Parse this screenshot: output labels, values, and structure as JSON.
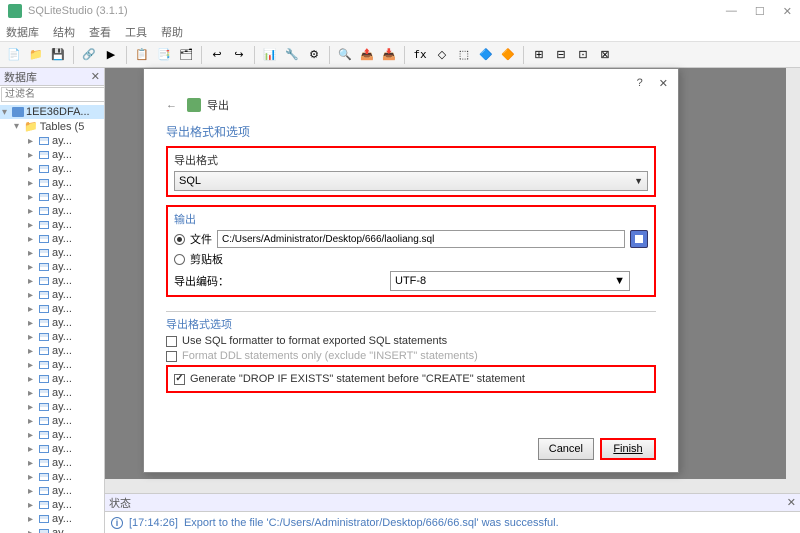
{
  "app": {
    "title": "SQLiteStudio (3.1.1)"
  },
  "menu": {
    "database": "数据库",
    "structure": "结构",
    "view": "查看",
    "tools": "工具",
    "help": "帮助"
  },
  "sidebar": {
    "header": "数据库",
    "filter_placeholder": "过滤名",
    "db_name": "1EE36DFA...",
    "tables_label": "Tables (5",
    "items": [
      {
        "label": "ay..."
      },
      {
        "label": "ay..."
      },
      {
        "label": "ay..."
      },
      {
        "label": "ay..."
      },
      {
        "label": "ay..."
      },
      {
        "label": "ay..."
      },
      {
        "label": "ay..."
      },
      {
        "label": "ay..."
      },
      {
        "label": "ay..."
      },
      {
        "label": "ay..."
      },
      {
        "label": "ay..."
      },
      {
        "label": "ay..."
      },
      {
        "label": "ay..."
      },
      {
        "label": "ay..."
      },
      {
        "label": "ay..."
      },
      {
        "label": "ay..."
      },
      {
        "label": "ay..."
      },
      {
        "label": "ay..."
      },
      {
        "label": "ay..."
      },
      {
        "label": "ay..."
      },
      {
        "label": "ay..."
      },
      {
        "label": "ay..."
      },
      {
        "label": "ay..."
      },
      {
        "label": "ay..."
      },
      {
        "label": "ay..."
      },
      {
        "label": "ay..."
      },
      {
        "label": "ay..."
      },
      {
        "label": "ay..."
      },
      {
        "label": "ay..."
      }
    ]
  },
  "status": {
    "header": "状态",
    "timestamp": "[17:14:26]",
    "message": "Export to the file 'C:/Users/Administrator/Desktop/666/66.sql' was successful."
  },
  "dialog": {
    "title": "导出",
    "section_title": "导出格式和选项",
    "format_label": "导出格式",
    "format_value": "SQL",
    "output_label": "输出",
    "file_radio": "文件",
    "file_path": "C:/Users/Administrator/Desktop/666/laoliang.sql",
    "clipboard_radio": "剪贴板",
    "encoding_label": "导出编码：",
    "encoding_value": "UTF-8",
    "format_opts_label": "导出格式选项",
    "chk_formatter": "Use SQL formatter to format exported SQL statements",
    "chk_blurred": "Format DDL statements only (exclude \"INSERT\" statements)",
    "chk_drop": "Generate \"DROP IF EXISTS\" statement before \"CREATE\" statement",
    "btn_cancel": "Cancel",
    "btn_finish": "Finish"
  }
}
